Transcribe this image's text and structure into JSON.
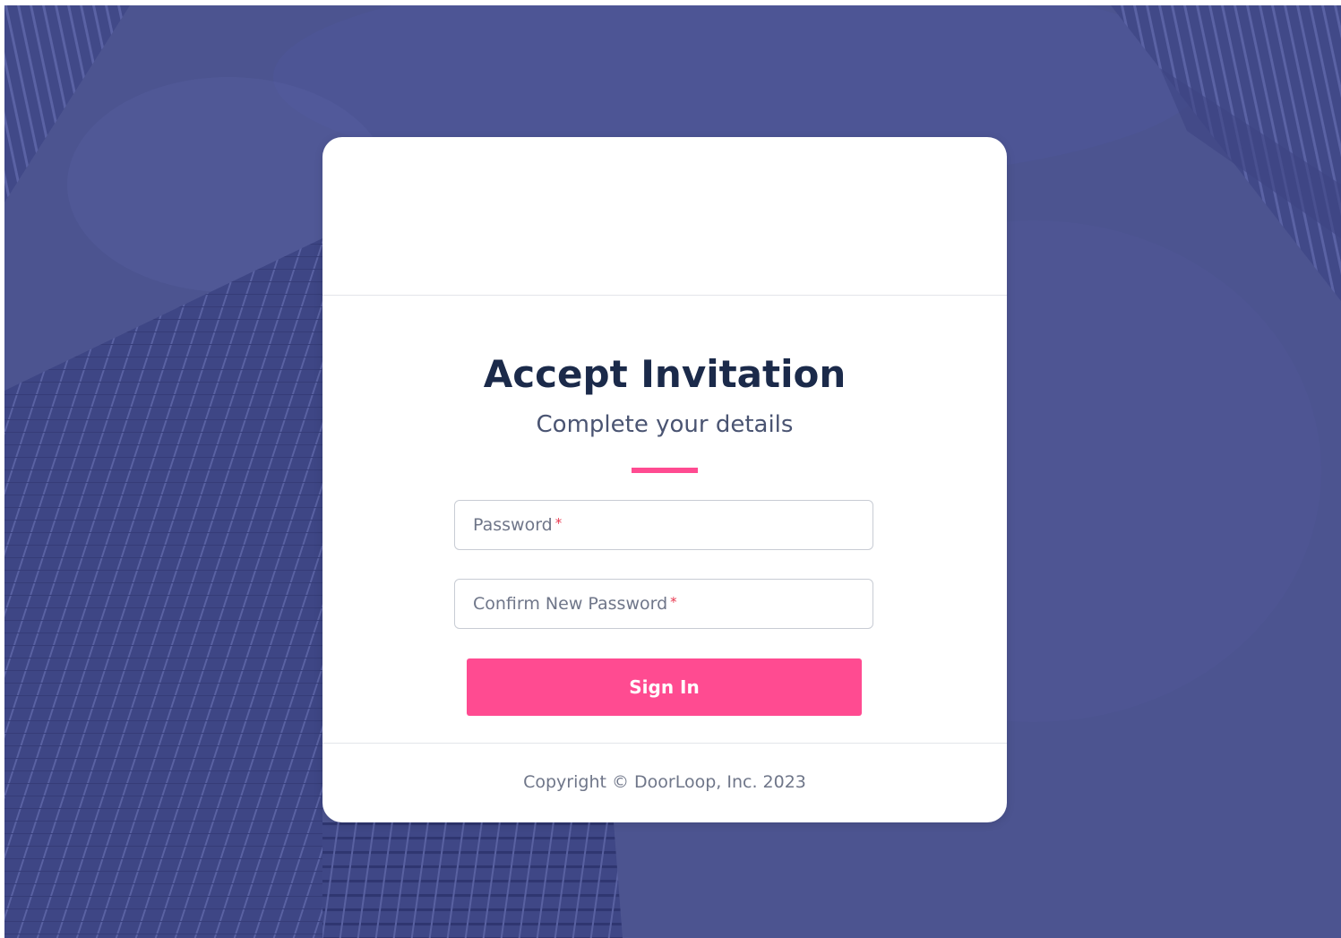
{
  "colors": {
    "background_overlay": "#4a528c",
    "card": "#ffffff",
    "title": "#1b2a4a",
    "accent": "#ff4b91",
    "required_star": "#e8384f",
    "muted_text": "#6f7689"
  },
  "form": {
    "title": "Accept Invitation",
    "subtitle": "Complete your details",
    "password_label": "Password",
    "confirm_password_label": "Confirm New Password",
    "required_marker": "*",
    "submit_label": "Sign In"
  },
  "footer": {
    "copyright": "Copyright © DoorLoop, Inc. 2023"
  }
}
